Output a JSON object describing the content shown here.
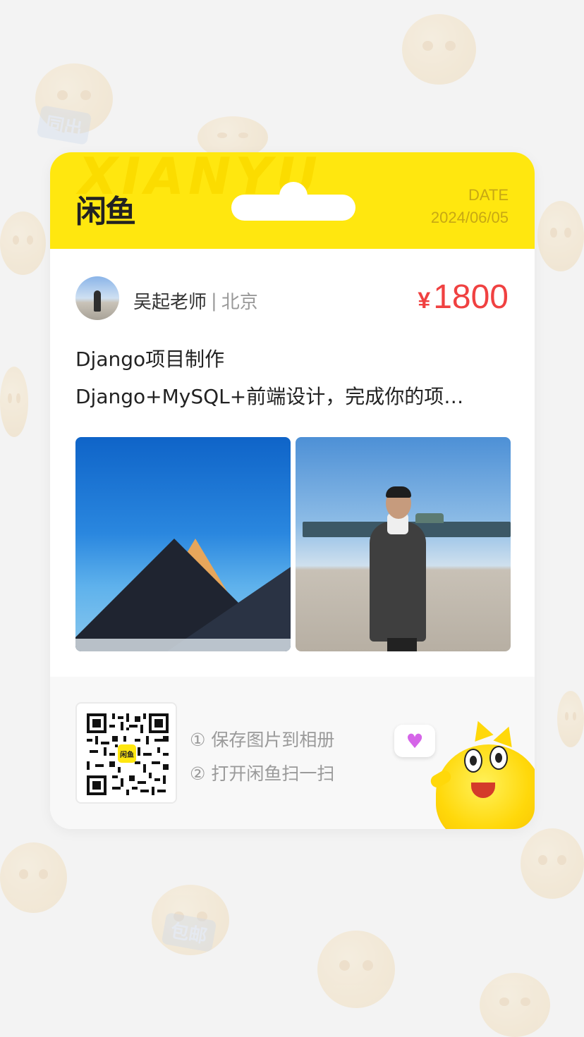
{
  "background": {
    "tags": [
      "同出",
      "包邮"
    ]
  },
  "card": {
    "header": {
      "watermark": "XIANYU",
      "logo": "闲鱼",
      "date_label": "DATE",
      "date_value": "2024/06/05"
    },
    "seller": {
      "name": "吴起老师",
      "separator": "|",
      "location": "北京"
    },
    "price": {
      "symbol": "¥",
      "amount": "1800"
    },
    "item": {
      "title": "Django项目制作",
      "description": "Django+MySQL+前端设计，完成你的项…"
    },
    "photos": [
      {
        "kind": "mountain-photo"
      },
      {
        "kind": "man-at-temple-photo"
      }
    ],
    "footer": {
      "qr_logo": "闲鱼",
      "step1": "① 保存图片到相册",
      "step2": "② 打开闲鱼扫一扫",
      "heart": "♥"
    }
  },
  "colors": {
    "brand_yellow": "#ffe70f",
    "price_red": "#f04141",
    "date_gold": "#c7a814",
    "page_bg": "#f3f3f3"
  }
}
